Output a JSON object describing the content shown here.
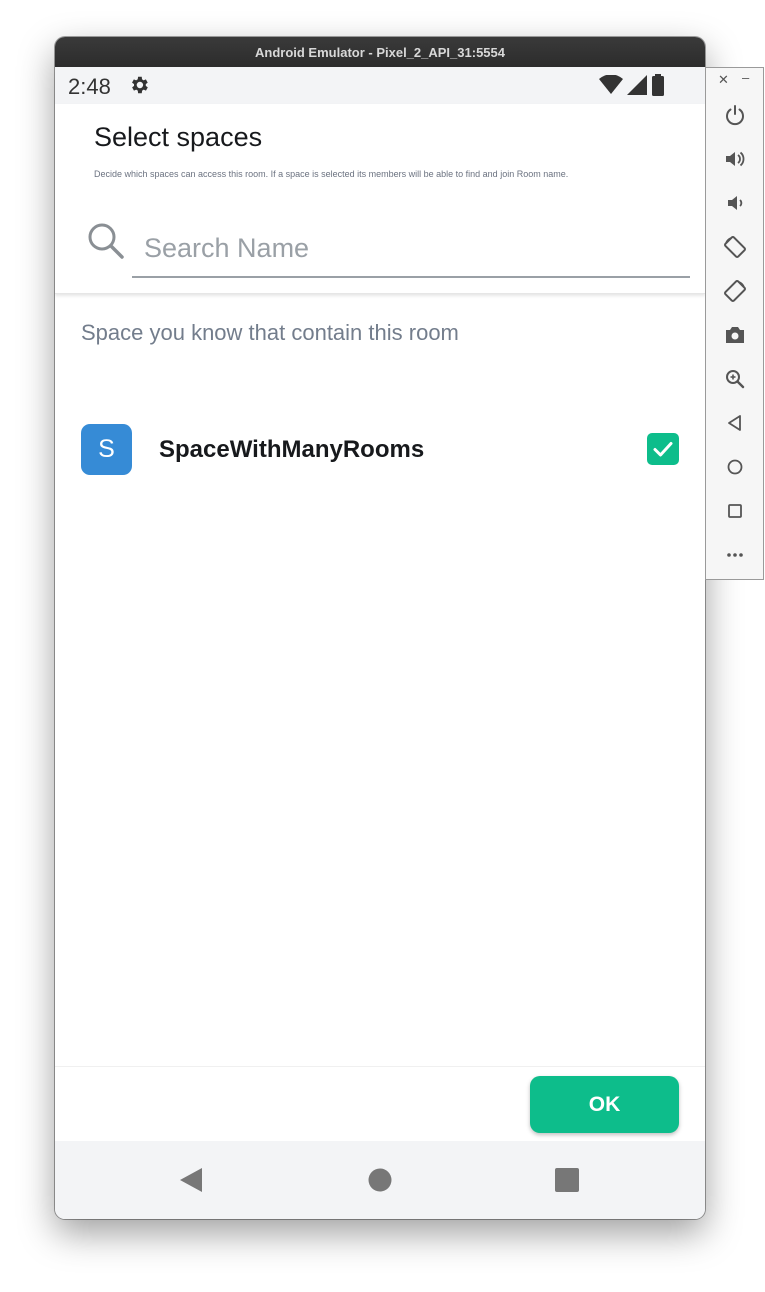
{
  "window": {
    "title": "Android Emulator - Pixel_2_API_31:5554"
  },
  "status_bar": {
    "time": "2:48"
  },
  "header": {
    "title": "Select spaces",
    "description": "Decide which spaces can access this room. If a space is selected its members will be able to find and join Room name."
  },
  "search": {
    "placeholder": "Search Name",
    "value": ""
  },
  "section": {
    "label": "Space you know that contain this room"
  },
  "spaces": [
    {
      "avatar_letter": "S",
      "name": "SpaceWithManyRooms",
      "checked": true
    }
  ],
  "actions": {
    "ok_label": "OK"
  },
  "colors": {
    "accent": "#0dbd8b",
    "avatar": "#368bd6",
    "muted_text": "#737d8c"
  },
  "nav_bar": {
    "icons": [
      "back-icon",
      "home-icon",
      "recents-icon"
    ]
  },
  "emulator_toolbar": {
    "icons": [
      "close-icon",
      "minimize-icon",
      "power-icon",
      "volume-up-icon",
      "volume-down-icon",
      "rotate-left-icon",
      "rotate-right-icon",
      "camera-icon",
      "zoom-icon",
      "back-icon",
      "home-icon",
      "overview-icon",
      "more-icon"
    ]
  }
}
